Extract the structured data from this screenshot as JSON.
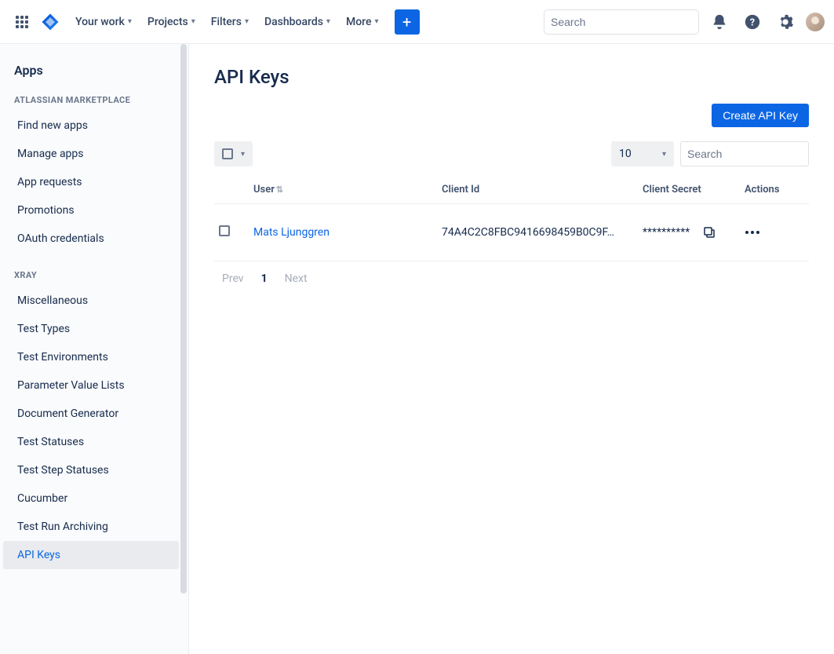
{
  "topnav": {
    "items": [
      "Your work",
      "Projects",
      "Filters",
      "Dashboards",
      "More"
    ],
    "search_placeholder": "Search"
  },
  "sidebar": {
    "title": "Apps",
    "sections": [
      {
        "label": "ATLASSIAN MARKETPLACE",
        "items": [
          "Find new apps",
          "Manage apps",
          "App requests",
          "Promotions",
          "OAuth credentials"
        ]
      },
      {
        "label": "XRAY",
        "items": [
          "Miscellaneous",
          "Test Types",
          "Test Environments",
          "Parameter Value Lists",
          "Document Generator",
          "Test Statuses",
          "Test Step Statuses",
          "Cucumber",
          "Test Run Archiving",
          "API Keys"
        ]
      }
    ],
    "active": "API Keys"
  },
  "page": {
    "title": "API Keys",
    "create_label": "Create API Key",
    "page_size": "10",
    "table_search_placeholder": "Search",
    "columns": {
      "user": "User",
      "client_id": "Client Id",
      "client_secret": "Client Secret",
      "actions": "Actions"
    },
    "rows": [
      {
        "user": "Mats Ljunggren",
        "client_id": "74A4C2C8FBC9416698459B0C9F…",
        "client_secret": "**********"
      }
    ],
    "pagination": {
      "prev": "Prev",
      "current": "1",
      "next": "Next"
    }
  }
}
